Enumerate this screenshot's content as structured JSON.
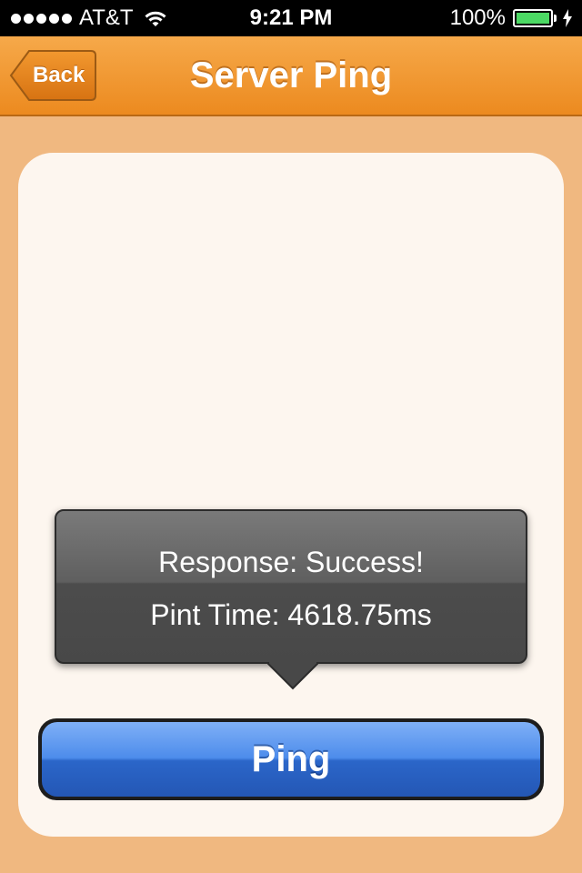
{
  "status_bar": {
    "carrier": "AT&T",
    "time": "9:21 PM",
    "battery_percent": "100%",
    "signal_bars": 5,
    "battery_level": 1.0,
    "battery_color": "#4cd964"
  },
  "nav_bar": {
    "back_label": "Back",
    "title": "Server Ping",
    "color": "#ec8a1f"
  },
  "popover": {
    "response": "Response: Success!",
    "ping_time": "Pint Time: 4618.75ms"
  },
  "ping_button": {
    "label": "Ping",
    "color": "#2b66c9"
  }
}
